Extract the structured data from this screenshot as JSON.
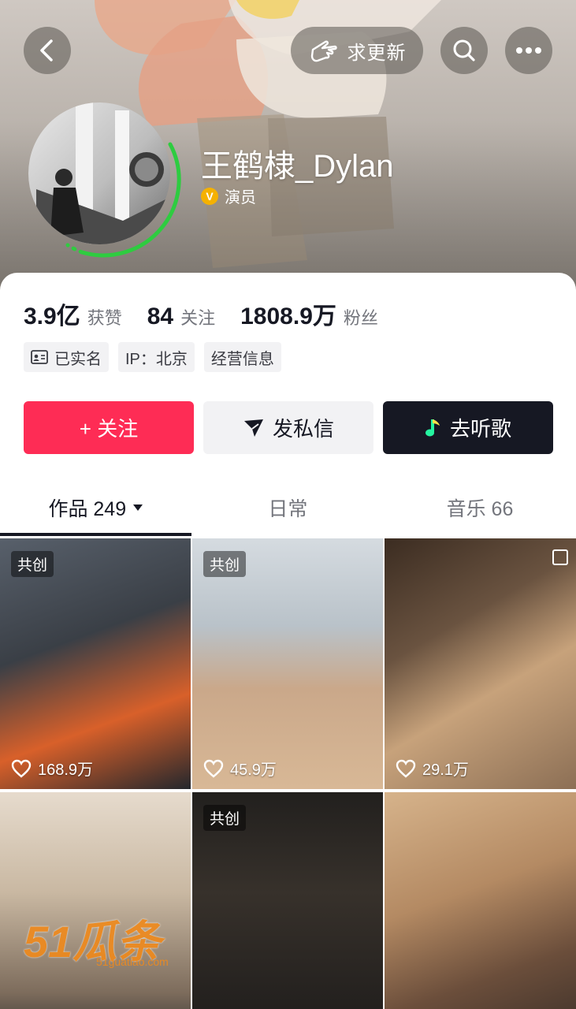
{
  "header": {
    "update_label": "求更新",
    "name": "王鹤棣_Dylan",
    "verify_label": "演员"
  },
  "stats": {
    "likes": {
      "num": "3.9亿",
      "label": "获赞"
    },
    "following": {
      "num": "84",
      "label": "关注"
    },
    "followers": {
      "num": "1808.9万",
      "label": "粉丝"
    }
  },
  "tags": {
    "realname": "已实名",
    "ip": "IP：北京",
    "business": "经营信息"
  },
  "actions": {
    "follow": "+ 关注",
    "message": "发私信",
    "music": "去听歌"
  },
  "tabs": [
    {
      "label": "作品 249"
    },
    {
      "label": "日常"
    },
    {
      "label": "音乐 66"
    }
  ],
  "videos": [
    {
      "badge": "共创",
      "likes": "168.9万"
    },
    {
      "badge": "共创",
      "likes": "45.9万"
    },
    {
      "likes": "29.1万"
    },
    {},
    {
      "badge": "共创"
    },
    {}
  ],
  "watermark": {
    "brand": "51瓜条",
    "url": "51guatiao.com"
  },
  "colors": {
    "accent": "#fe2c55",
    "dark": "#161823",
    "verify": "#f5b100",
    "ring": "#2ecc40"
  },
  "icons": [
    "back-icon",
    "hand-icon",
    "search-icon",
    "more-icon",
    "idcard-icon",
    "send-icon",
    "music-note-icon",
    "dropdown-icon",
    "heart-icon"
  ]
}
